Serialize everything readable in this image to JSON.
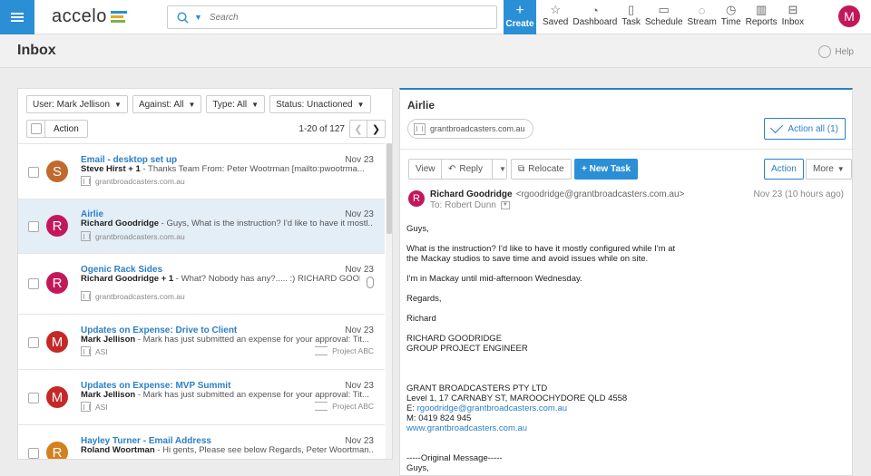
{
  "app": {
    "logo": "accelo"
  },
  "search": {
    "placeholder": "Search"
  },
  "create": {
    "label": "Create"
  },
  "nav": [
    {
      "label": "Saved",
      "icon": "star-icon"
    },
    {
      "label": "Dashboard",
      "icon": "gauge-icon"
    },
    {
      "label": "Task",
      "icon": "clipboard-icon"
    },
    {
      "label": "Schedule",
      "icon": "calendar-icon"
    },
    {
      "label": "Stream",
      "icon": "chat-icon"
    },
    {
      "label": "Time",
      "icon": "clock-icon"
    },
    {
      "label": "Reports",
      "icon": "bar-chart-icon"
    },
    {
      "label": "Inbox",
      "icon": "inbox-icon"
    }
  ],
  "user": {
    "initial": "M",
    "color": "#c2185b"
  },
  "page": {
    "title": "Inbox",
    "help": "Help"
  },
  "filters": [
    "User: Mark Jellison",
    "Against: All",
    "Type: All",
    "Status: Unactioned"
  ],
  "list_actions": {
    "action": "Action",
    "count": "1-20 of 127"
  },
  "messages": [
    {
      "subject": "Email - desktop set up",
      "date": "Nov 23",
      "sender": "Steve Hirst",
      "extra": "+ 1",
      "preview": "Thanks Team From: Peter Wootrman [mailto:pwootrma...",
      "against": "grantbroadcasters.com.au",
      "project": "",
      "initial": "S",
      "color": "#c06a2e",
      "selected": false,
      "attachment": false
    },
    {
      "subject": "Airlie",
      "date": "Nov 23",
      "sender": "Richard Goodridge",
      "extra": "",
      "preview": "Guys, What is the instruction? I'd like to have it mostl...",
      "against": "grantbroadcasters.com.au",
      "project": "",
      "initial": "R",
      "color": "#c2185b",
      "selected": true,
      "attachment": false
    },
    {
      "subject": "Ogenic Rack Sides",
      "date": "Nov 23",
      "sender": "Richard Goodridge",
      "extra": "+ 1",
      "preview": "What? Nobody has any?..... :) RICHARD GOOD...",
      "against": "grantbroadcasters.com.au",
      "project": "",
      "initial": "R",
      "color": "#c2185b",
      "selected": false,
      "attachment": true
    },
    {
      "subject": "Updates on Expense: Drive to Client",
      "date": "Nov 23",
      "sender": "Mark Jellison",
      "extra": "",
      "preview": "Mark has just submitted an expense for your approval: Tit...",
      "against": "ASI",
      "project": "Project ABC",
      "initial": "M",
      "color": "#c62828",
      "selected": false,
      "attachment": false
    },
    {
      "subject": "Updates on Expense: MVP Summit",
      "date": "Nov 23",
      "sender": "Mark Jellison",
      "extra": "",
      "preview": "Mark has just submitted an expense for your approval: Tit...",
      "against": "ASI",
      "project": "Project ABC",
      "initial": "M",
      "color": "#c62828",
      "selected": false,
      "attachment": false
    },
    {
      "subject": "Hayley Turner - Email Address",
      "date": "Nov 23",
      "sender": "Roland Woortman",
      "extra": "",
      "preview": "Hi gents, Please see below Regards, Peter Woortman...",
      "against": "",
      "project": "",
      "initial": "R",
      "color": "#d4801f",
      "selected": false,
      "attachment": false
    }
  ],
  "detail": {
    "title": "Airlie",
    "tag": "grantbroadcasters.com.au",
    "action_all": "Action all (1)",
    "toolbar": {
      "view": "View",
      "reply": "Reply",
      "relocate": "Relocate",
      "new_task": "+ New Task",
      "action": "Action",
      "more": "More"
    },
    "from_name": "Richard Goodridge",
    "from_email": "<rgoodridge@grantbroadcasters.com.au>",
    "to": "To: Robert Dunn",
    "date": "Nov 23 (10 hours ago)",
    "initial": "R",
    "body": {
      "p1": "Guys,",
      "p2": "What is the instruction? I'd like to have it mostly configured while I'm at\nthe Mackay studios to save time and avoid issues while on site.",
      "p3": "I'm in Mackay until mid-afternoon Wednesday.",
      "p4": "Regards,",
      "p5": "Richard",
      "p6": "RICHARD GOODRIDGE\nGROUP PROJECT ENGINEER",
      "p7": "GRANT BROADCASTERS PTY LTD\nLevel 1, 17 CARNABY ST, MAROOCHYDORE QLD 4558",
      "email_prefix": "E: ",
      "email": "rgoodridge@grantbroadcasters.com.au",
      "phone": "M: 0419 824 945",
      "website": "www.grantbroadcasters.com.au",
      "orig": "-----Original Message-----",
      "orig2": "Guys,"
    }
  }
}
